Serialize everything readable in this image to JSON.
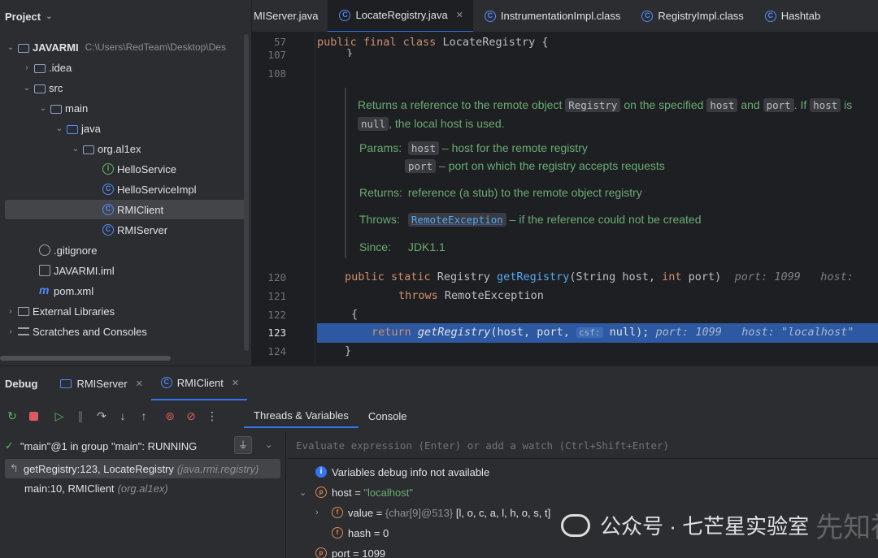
{
  "project": {
    "title": "Project",
    "tree": [
      {
        "label": "JAVARMI",
        "path": "C:\\Users\\RedTeam\\Desktop\\Des",
        "icon": "module-folder-icon"
      },
      {
        "label": ".idea",
        "icon": "folder-icon"
      },
      {
        "label": "src",
        "icon": "folder-icon"
      },
      {
        "label": "main",
        "icon": "folder-icon"
      },
      {
        "label": "java",
        "icon": "source-folder-icon"
      },
      {
        "label": "org.al1ex",
        "icon": "package-icon"
      },
      {
        "label": "HelloService",
        "icon": "interface-icon"
      },
      {
        "label": "HelloServiceImpl",
        "icon": "class-icon"
      },
      {
        "label": "RMIClient",
        "icon": "runnable-class-icon"
      },
      {
        "label": "RMIServer",
        "icon": "runnable-class-icon"
      },
      {
        "label": ".gitignore",
        "icon": "gitignore-icon"
      },
      {
        "label": "JAVARMI.iml",
        "icon": "iml-file-icon"
      },
      {
        "label": "pom.xml",
        "icon": "maven-icon"
      },
      {
        "label": "External Libraries",
        "icon": "libraries-icon"
      },
      {
        "label": "Scratches and Consoles",
        "icon": "scratches-icon"
      }
    ]
  },
  "editor": {
    "tabs": [
      {
        "label": "MIServer.java"
      },
      {
        "label": "LocateRegistry.java",
        "close": "✕"
      },
      {
        "label": "InstrumentationImpl.class"
      },
      {
        "label": "RegistryImpl.class"
      },
      {
        "label": "Hashtab"
      }
    ],
    "line_numbers": [
      "57",
      "107",
      "108",
      "120",
      "121",
      "122",
      "123",
      "124"
    ],
    "code": {
      "l57_kw": "public final class",
      "l57_name": " LocateRegistry {",
      "l107": "}",
      "l120_kw": "public static",
      "l120_type": " Registry ",
      "l120_fn": "getRegistry",
      "l120_args": "(String host, ",
      "l120_int": "int",
      "l120_rest": " port)",
      "l120_hint1": "port: 1099",
      "l120_hint2": "host:",
      "l121_kw": "throws",
      "l121_rest": " RemoteException",
      "l122": "{",
      "l123_kw": "return",
      "l123_fn": "getRegistry",
      "l123_args": "(host, port, ",
      "l123_param": "csf:",
      "l123_rest": " null);",
      "l123_hint1": "port: 1099",
      "l123_hint2": "host: \"localhost\"",
      "l124": "}"
    },
    "doc": {
      "t1": "Returns a reference to the remote object",
      "c1": "Registry",
      "t2": "on the specified",
      "c2": "host",
      "t3": "and",
      "c3": "port",
      "t4": ". If",
      "c4": "host",
      "t5": "is",
      "c5": "null",
      "t6": ", the local host is used.",
      "params_label": "Params:",
      "p1_name": "host",
      "p1_desc": "– host for the remote registry",
      "p2_name": "port",
      "p2_desc": "– port on which the registry accepts requests",
      "returns_label": "Returns:",
      "returns_desc": "reference (a stub) to the remote object registry",
      "throws_label": "Throws:",
      "throws_name": "RemoteException",
      "throws_desc": "– if the reference could not be created",
      "since_label": "Since:",
      "since_val": "JDK1.1"
    }
  },
  "debug": {
    "title": "Debug",
    "tabs": [
      {
        "label": "RMIServer",
        "close": "✕"
      },
      {
        "label": "RMIClient",
        "close": "✕"
      }
    ],
    "subtabs": [
      "Threads & Variables",
      "Console"
    ],
    "thread": "\"main\"@1 in group \"main\": RUNNING",
    "frames": [
      {
        "method": "getRegistry:123, LocateRegistry",
        "pkg": "(java.rmi.registry)"
      },
      {
        "method": "main:10, RMIClient",
        "pkg": "(org.al1ex)"
      }
    ],
    "eval_placeholder": "Evaluate expression (Enter) or add a watch (Ctrl+Shift+Enter)",
    "variables": {
      "info": "Variables debug info not available",
      "host_name": "host",
      "host_val": "\"localhost\"",
      "value_name": "value",
      "value_ref": "{char[9]@513}",
      "value_val": "[l, o, c, a, l, h, o, s, t]",
      "hash_name": "hash",
      "hash_val": "0",
      "port_name": "port",
      "port_val": "1099"
    }
  },
  "watermark": {
    "text": "公众号 · 七芒星实验室",
    "bg_text": "先知社区"
  },
  "colors": {
    "accent": "#3574f0",
    "exec_line": "#2d59a3",
    "keyword": "#cf8e6d",
    "function": "#56a8f5",
    "doc": "#6aab73"
  }
}
